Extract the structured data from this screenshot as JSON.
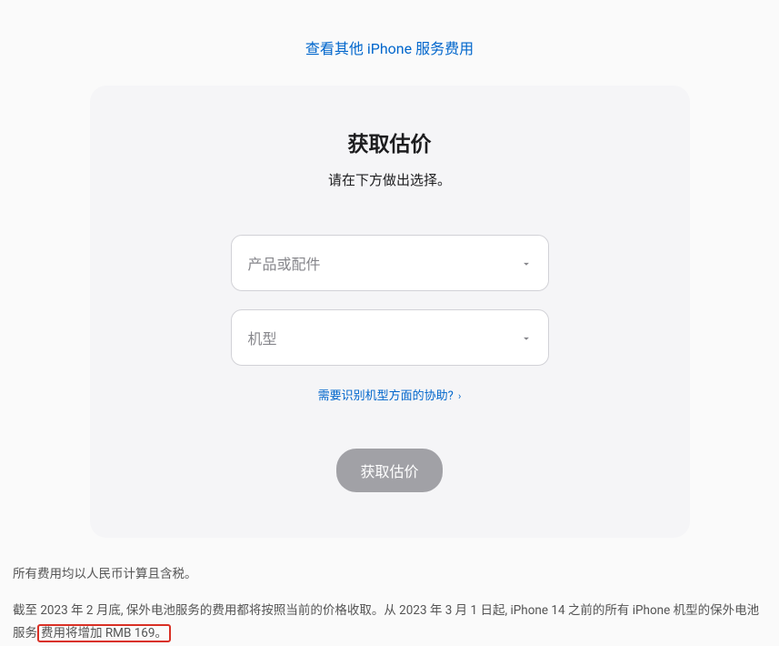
{
  "top_link": "查看其他 iPhone 服务费用",
  "card": {
    "title": "获取估价",
    "subtitle": "请在下方做出选择。",
    "select_product_placeholder": "产品或配件",
    "select_model_placeholder": "机型",
    "help_link": "需要识别机型方面的协助?",
    "submit_label": "获取估价"
  },
  "footer": {
    "line1": "所有费用均以人民币计算且含税。",
    "line2_part1": "截至 2023 年 2 月底, 保外电池服务的费用都将按照当前的价格收取。从 2023 年 3 月 1 日起, iPhone 14 之前的所有 iPhone 机型的保外电池服务",
    "line2_highlight": "费用将增加 RMB 169。"
  }
}
